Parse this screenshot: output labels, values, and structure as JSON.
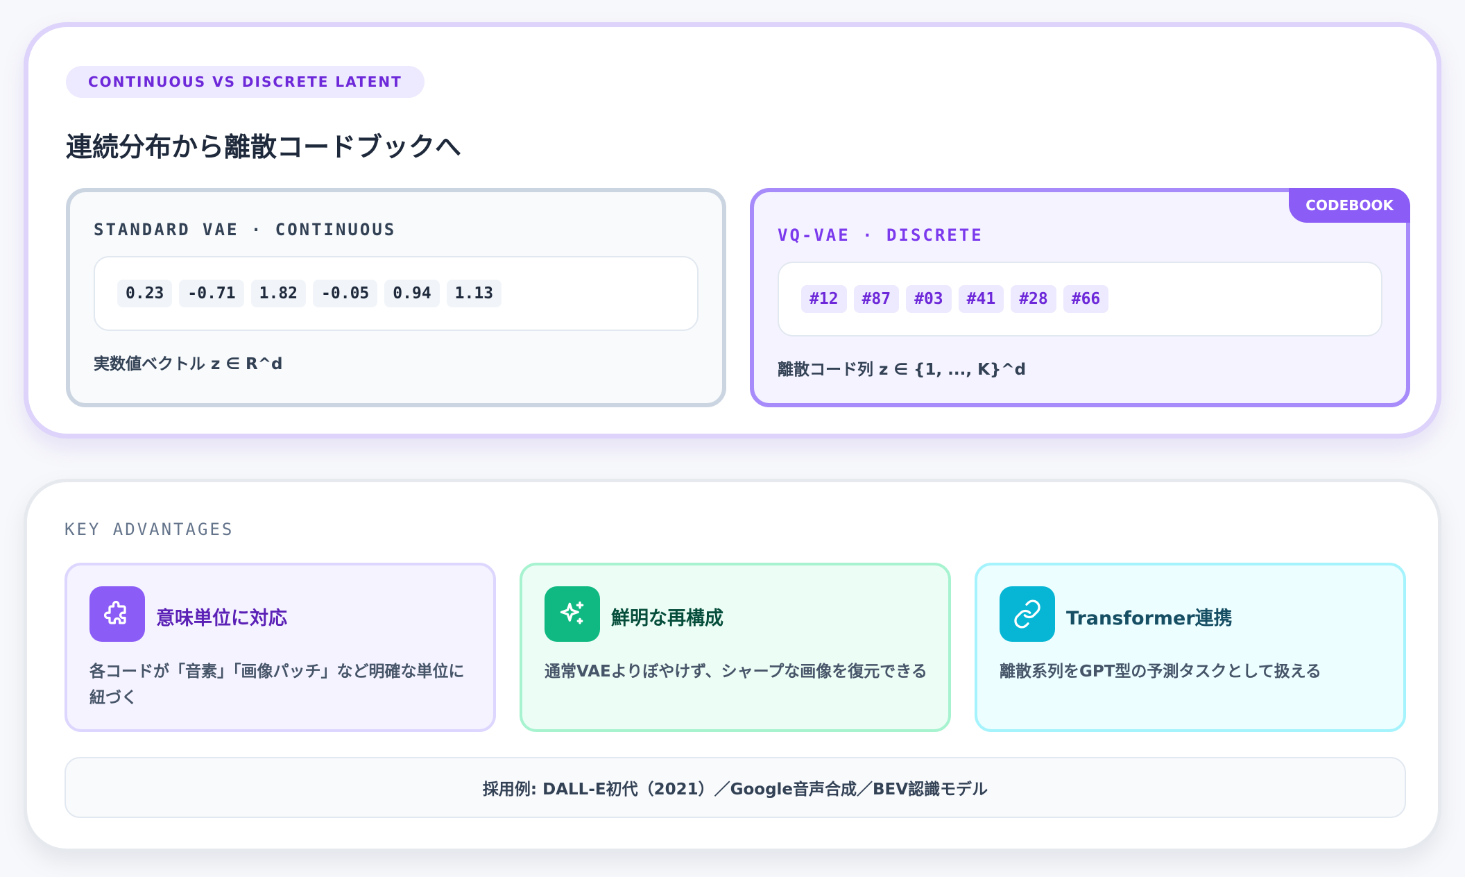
{
  "header": {
    "pill": "CONTINUOUS VS DISCRETE LATENT",
    "title": "連続分布から離散コードブックへ"
  },
  "vae_card": {
    "label": "STANDARD VAE · CONTINUOUS",
    "values": [
      "0.23",
      "-0.71",
      "1.82",
      "-0.05",
      "0.94",
      "1.13"
    ],
    "caption": "実数値ベクトル z ∈ R^d"
  },
  "vq_card": {
    "tag": "CODEBOOK",
    "label": "VQ-VAE · DISCRETE",
    "codes": [
      "#12",
      "#87",
      "#03",
      "#41",
      "#28",
      "#66"
    ],
    "caption": "離散コード列 z ∈ {1, ..., K}^d"
  },
  "advantages": {
    "section_label": "KEY ADVANTAGES",
    "items": [
      {
        "icon": "puzzle-icon",
        "title": "意味単位に対応",
        "desc": "各コードが「音素」「画像パッチ」など明確な単位に紐づく",
        "color": "#8b5cf6"
      },
      {
        "icon": "sparkle-icon",
        "title": "鮮明な再構成",
        "desc": "通常VAEよりぼやけず、シャープな画像を復元できる",
        "color": "#10b981"
      },
      {
        "icon": "link-icon",
        "title": "Transformer連携",
        "desc": "離散系列をGPT型の予測タスクとして扱える",
        "color": "#06b6d4"
      }
    ]
  },
  "footer": {
    "text": "採用例: DALL-E初代（2021）／Google音声合成／BEV認識モデル"
  }
}
